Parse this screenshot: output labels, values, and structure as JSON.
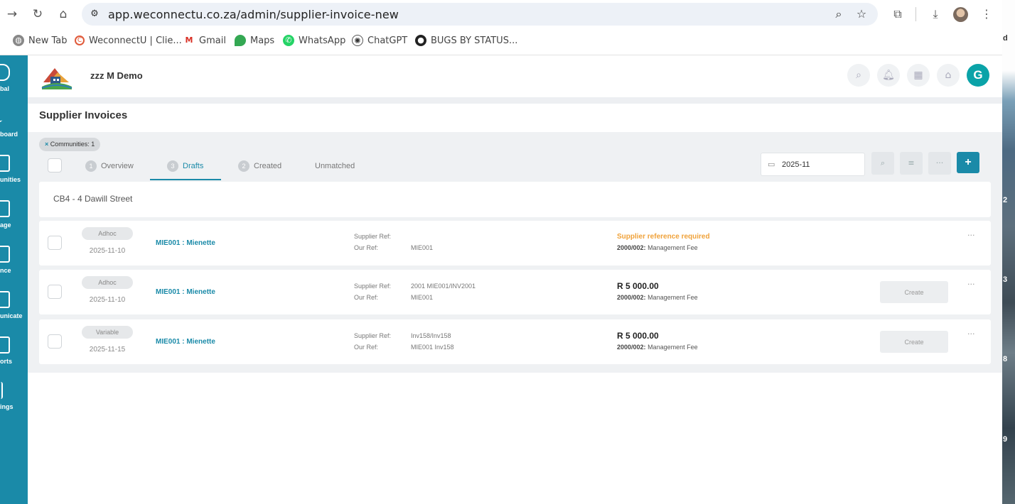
{
  "browser": {
    "url": "app.weconnectu.co.za/admin/supplier-invoice-new",
    "bookmarks": [
      {
        "label": "New Tab",
        "icon": "globe-icon"
      },
      {
        "label": "WeconnectU | Clie...",
        "icon": "weconnectu-icon"
      },
      {
        "label": "Gmail",
        "icon": "gmail-icon"
      },
      {
        "label": "Maps",
        "icon": "maps-icon"
      },
      {
        "label": "WhatsApp",
        "icon": "whatsapp-icon"
      },
      {
        "label": "ChatGPT",
        "icon": "chatgpt-icon"
      },
      {
        "label": "BUGS BY STATUS...",
        "icon": "github-icon"
      }
    ]
  },
  "sidebar": {
    "items": [
      {
        "label": "bal",
        "icon": "fingerprint-icon"
      },
      {
        "label": "board",
        "icon": "check-icon"
      },
      {
        "label": "unities",
        "icon": "building-icon"
      },
      {
        "label": "age",
        "icon": "clipboard-icon"
      },
      {
        "label": "nce",
        "icon": "wallet-icon"
      },
      {
        "label": "unicate",
        "icon": "message-icon"
      },
      {
        "label": "orts",
        "icon": "report-icon"
      },
      {
        "label": "ings",
        "icon": "sliders-icon"
      }
    ]
  },
  "header": {
    "org_name": "zzz M Demo",
    "avatar_initial": "G"
  },
  "page": {
    "title": "Supplier Invoices",
    "filter_chip": "Communities: 1",
    "tabs": [
      {
        "count": "1",
        "label": "Overview"
      },
      {
        "count": "3",
        "label": "Drafts"
      },
      {
        "count": "2",
        "label": "Created"
      },
      {
        "count": "",
        "label": "Unmatched"
      }
    ],
    "period": "2025-11",
    "group": "CB4 - 4 Dawill Street"
  },
  "rows": [
    {
      "type": "Adhoc",
      "date": "2025-11-10",
      "supplier": "MIE001 : Mienette",
      "supplier_ref_label": "Supplier Ref:",
      "supplier_ref": "",
      "our_ref_label": "Our Ref:",
      "our_ref": "MIE001",
      "warning": "Supplier reference required",
      "amount": "",
      "gl_code": "2000/002:",
      "gl_name": "Management Fee",
      "action": ""
    },
    {
      "type": "Adhoc",
      "date": "2025-11-10",
      "supplier": "MIE001 : Mienette",
      "supplier_ref_label": "Supplier Ref:",
      "supplier_ref": "2001 MIE001/INV2001",
      "our_ref_label": "Our Ref:",
      "our_ref": "MIE001",
      "warning": "",
      "amount": "R 5 000.00",
      "gl_code": "2000/002:",
      "gl_name": "Management Fee",
      "action": "Create"
    },
    {
      "type": "Variable",
      "date": "2025-11-15",
      "supplier": "MIE001 : Mienette",
      "supplier_ref_label": "Supplier Ref:",
      "supplier_ref": "Inv158/Inv158",
      "our_ref_label": "Our Ref:",
      "our_ref": "MIE001 Inv158",
      "warning": "",
      "amount": "R 5 000.00",
      "gl_code": "2000/002:",
      "gl_name": "Management Fee",
      "action": "Create"
    }
  ],
  "wallpaper_numbers": [
    "d",
    "2",
    "3",
    "8",
    "9"
  ]
}
